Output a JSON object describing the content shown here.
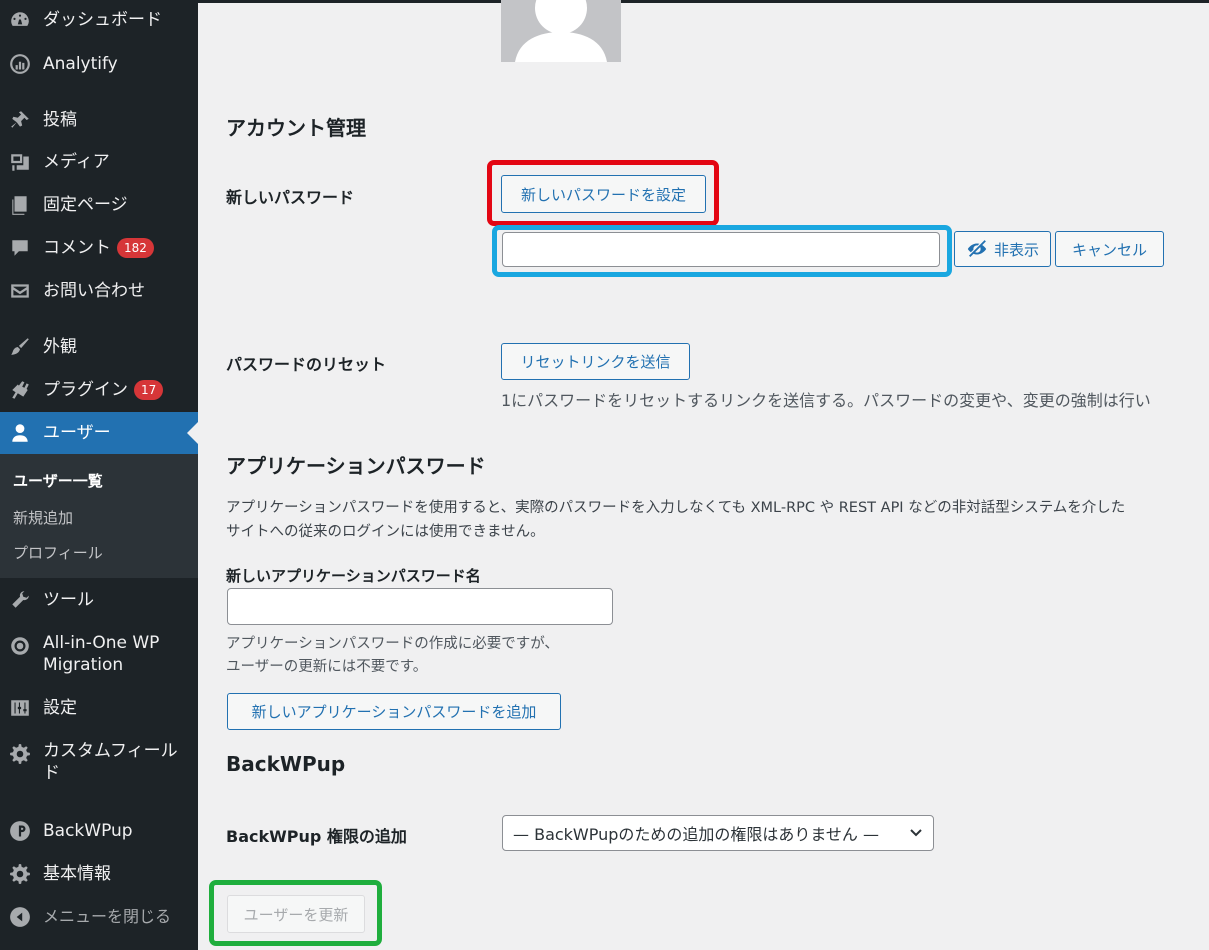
{
  "sidebar": {
    "items": [
      {
        "label": "ダッシュボード",
        "icon": "dashboard-icon"
      },
      {
        "label": "Analytify",
        "icon": "analytify-icon"
      },
      {
        "label": "投稿",
        "icon": "pin-icon"
      },
      {
        "label": "メディア",
        "icon": "media-icon"
      },
      {
        "label": "固定ページ",
        "icon": "pages-icon"
      },
      {
        "label": "コメント",
        "icon": "comment-icon",
        "badge": "182"
      },
      {
        "label": "お問い合わせ",
        "icon": "mail-icon"
      },
      {
        "label": "外観",
        "icon": "brush-icon"
      },
      {
        "label": "プラグイン",
        "icon": "plugin-icon",
        "badge": "17"
      },
      {
        "label": "ユーザー",
        "icon": "user-icon"
      },
      {
        "label": "ツール",
        "icon": "wrench-icon"
      },
      {
        "label_line1": "All-in-One WP",
        "label_line2": "Migration",
        "icon": "migration-icon"
      },
      {
        "label": "設定",
        "icon": "settings-sliders-icon"
      },
      {
        "label_line1": "カスタムフィール",
        "label_line2": "ド",
        "icon": "gear-icon"
      },
      {
        "label": "BackWPup",
        "icon": "backwpup-icon"
      },
      {
        "label": "基本情報",
        "icon": "gear-icon"
      },
      {
        "label": "メニューを閉じる",
        "icon": "collapse-icon"
      }
    ],
    "submenu": [
      "ユーザー一覧",
      "新規追加",
      "プロフィール"
    ]
  },
  "account": {
    "heading": "アカウント管理",
    "new_password_label": "新しいパスワード",
    "set_password_button": "新しいパスワードを設定",
    "password_value": "",
    "hide_button": "非表示",
    "cancel_button": "キャンセル",
    "reset_label": "パスワードのリセット",
    "reset_button": "リセットリンクを送信",
    "reset_desc": "1にパスワードをリセットするリンクを送信する。パスワードの変更や、変更の強制は行い"
  },
  "app_passwords": {
    "heading": "アプリケーションパスワード",
    "desc_line1": "アプリケーションパスワードを使用すると、実際のパスワードを入力しなくても XML-RPC や REST API などの非対話型システムを介した",
    "desc_line2": "サイトへの従来のログインには使用できません。",
    "name_label": "新しいアプリケーションパスワード名",
    "name_value": "",
    "hint_line1": "アプリケーションパスワードの作成に必要ですが、",
    "hint_line2": "ユーザーの更新には不要です。",
    "add_button": "新しいアプリケーションパスワードを追加"
  },
  "backwpup": {
    "heading": "BackWPup",
    "role_label": "BackWPup 権限の追加",
    "role_selected": "— BackWPupのための追加の権限はありません —"
  },
  "submit": {
    "update_button": "ユーザーを更新"
  },
  "colors": {
    "highlight_red": "#e30613",
    "highlight_blue": "#1aa7e0",
    "highlight_green": "#1fae3d",
    "accent": "#2271b1"
  }
}
